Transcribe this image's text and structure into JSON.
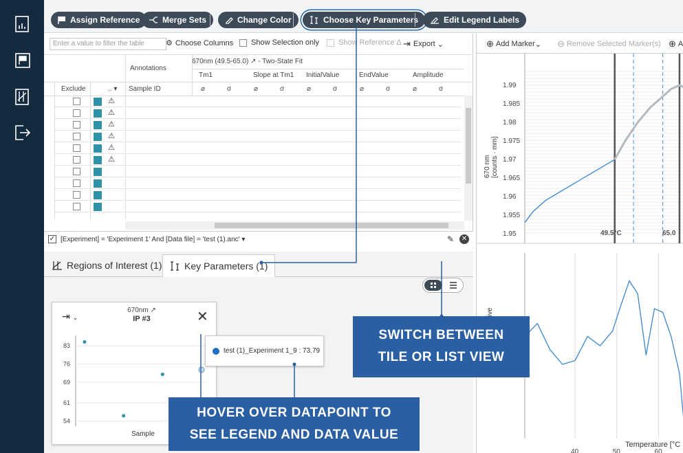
{
  "sidebar": {
    "icons": [
      "chart-icon",
      "flag-icon",
      "regions-icon",
      "export-icon"
    ]
  },
  "toolbar": {
    "assign_reference": "Assign Reference",
    "merge_sets": "Merge Sets",
    "change_color": "Change Color",
    "choose_key_parameters": "Choose Key Parameters",
    "edit_legend_labels": "Edit Legend Labels"
  },
  "table": {
    "filter_placeholder": "Enter a value to filter the table",
    "choose_columns": "Choose Columns",
    "show_selection_only": "Show Selection only",
    "show_reference": "Show Reference Δ",
    "export": "Export",
    "group_header": "670nm (49.5-65.0) ↗ - Two-State Fit",
    "annotations": "Annotations",
    "exclude": "Exclude",
    "dots": "..",
    "sample_id": "Sample ID",
    "params": [
      "Tm1",
      "Slope at Tm1",
      "InitialValue",
      "EndValue",
      "Amplitude"
    ],
    "sub": [
      "⌀",
      "σ",
      "⌀",
      "σ",
      "⌀",
      "σ",
      "⌀",
      "σ",
      "⌀",
      "σ"
    ],
    "rows": [
      {
        "warn": "⚠"
      },
      {
        "warn": "⚠"
      },
      {
        "warn": "⚠"
      },
      {
        "warn": "⚠"
      },
      {
        "warn": "⚠"
      },
      {
        "warn": "⚠"
      },
      {
        "warn": ""
      },
      {
        "warn": ""
      },
      {
        "warn": ""
      },
      {
        "warn": ""
      }
    ],
    "filter_expression": "[Experiment] = 'Experiment 1' And [Data file] = 'test (1).anc'"
  },
  "lower": {
    "tab_regions": "Regions of Interest (1)",
    "tab_key_params": "Key Parameters (1)"
  },
  "card": {
    "title": "670nm ↗",
    "subtitle": "IP #3",
    "x_label": "Sample"
  },
  "tooltip": {
    "text": "test (1)_Experiment 1_9 : 73.79"
  },
  "callouts": {
    "tile_list": [
      "SWITCH BETWEEN",
      "TILE OR LIST VIEW"
    ],
    "hover": [
      "HOVER OVER DATAPOINT TO",
      "SEE LEGEND AND DATA VALUE"
    ]
  },
  "right": {
    "add_marker": "Add Marker",
    "remove_marker": "Remove Selected Marker(s)",
    "add_more": "A",
    "y_label_1": "670 nm",
    "y_label_2": "[counts · mm]",
    "marker_1": "49.5°C",
    "marker_2": "65.0",
    "lower_y_label": "tive",
    "x_label": "Temperature [°C"
  },
  "chart_data": [
    {
      "type": "scatter",
      "title": "670nm ↗",
      "subtitle": "IP #3",
      "xlabel": "Sample",
      "ylabel": "",
      "y_ticks": [
        83,
        76,
        69,
        61,
        54
      ],
      "ylim": [
        52,
        87
      ],
      "series": [
        {
          "values": [
            {
              "x": 1,
              "y": 84.5
            },
            {
              "x": 2,
              "y": 56
            },
            {
              "x": 3,
              "y": 72
            },
            {
              "x": 4,
              "y": 73.79
            }
          ]
        }
      ]
    },
    {
      "type": "line",
      "xlabel": "Temperature [°C",
      "ylabel": "670 nm [counts · mm]",
      "y_ticks": [
        1.99,
        1.985,
        1.98,
        1.975,
        1.97,
        1.965,
        1.96,
        1.955,
        1.95
      ],
      "ylim": [
        1.95,
        1.99
      ],
      "series": [
        {
          "values": [
            {
              "x": 28,
              "y": 1.953
            },
            {
              "x": 30,
              "y": 1.956
            },
            {
              "x": 33,
              "y": 1.959
            },
            {
              "x": 36,
              "y": 1.961
            },
            {
              "x": 39,
              "y": 1.963
            },
            {
              "x": 42,
              "y": 1.965
            },
            {
              "x": 45,
              "y": 1.967
            },
            {
              "x": 48,
              "y": 1.969
            },
            {
              "x": 49.5,
              "y": 1.97
            },
            {
              "x": 52,
              "y": 1.975
            },
            {
              "x": 55,
              "y": 1.98
            },
            {
              "x": 58,
              "y": 1.984
            },
            {
              "x": 61,
              "y": 1.987
            },
            {
              "x": 63,
              "y": 1.989
            },
            {
              "x": 65,
              "y": 1.99
            },
            {
              "x": 66,
              "y": 1.9895
            }
          ]
        }
      ]
    },
    {
      "type": "line",
      "xlabel": "Temperature [°C",
      "x_ticks": [
        40,
        50,
        60
      ],
      "xlim": [
        28,
        66
      ],
      "series": [
        {
          "values": [
            {
              "x": 28,
              "y": 0.55
            },
            {
              "x": 31,
              "y": 0.62
            },
            {
              "x": 34,
              "y": 0.48
            },
            {
              "x": 37,
              "y": 0.4
            },
            {
              "x": 40,
              "y": 0.42
            },
            {
              "x": 43,
              "y": 0.55
            },
            {
              "x": 46,
              "y": 0.5
            },
            {
              "x": 49,
              "y": 0.58
            },
            {
              "x": 51,
              "y": 0.72
            },
            {
              "x": 53,
              "y": 0.85
            },
            {
              "x": 55,
              "y": 0.78
            },
            {
              "x": 57,
              "y": 0.45
            },
            {
              "x": 59,
              "y": 0.7
            },
            {
              "x": 61,
              "y": 0.68
            },
            {
              "x": 63,
              "y": 0.55
            },
            {
              "x": 65,
              "y": 0.35
            },
            {
              "x": 66,
              "y": 0.1
            }
          ]
        }
      ]
    }
  ]
}
